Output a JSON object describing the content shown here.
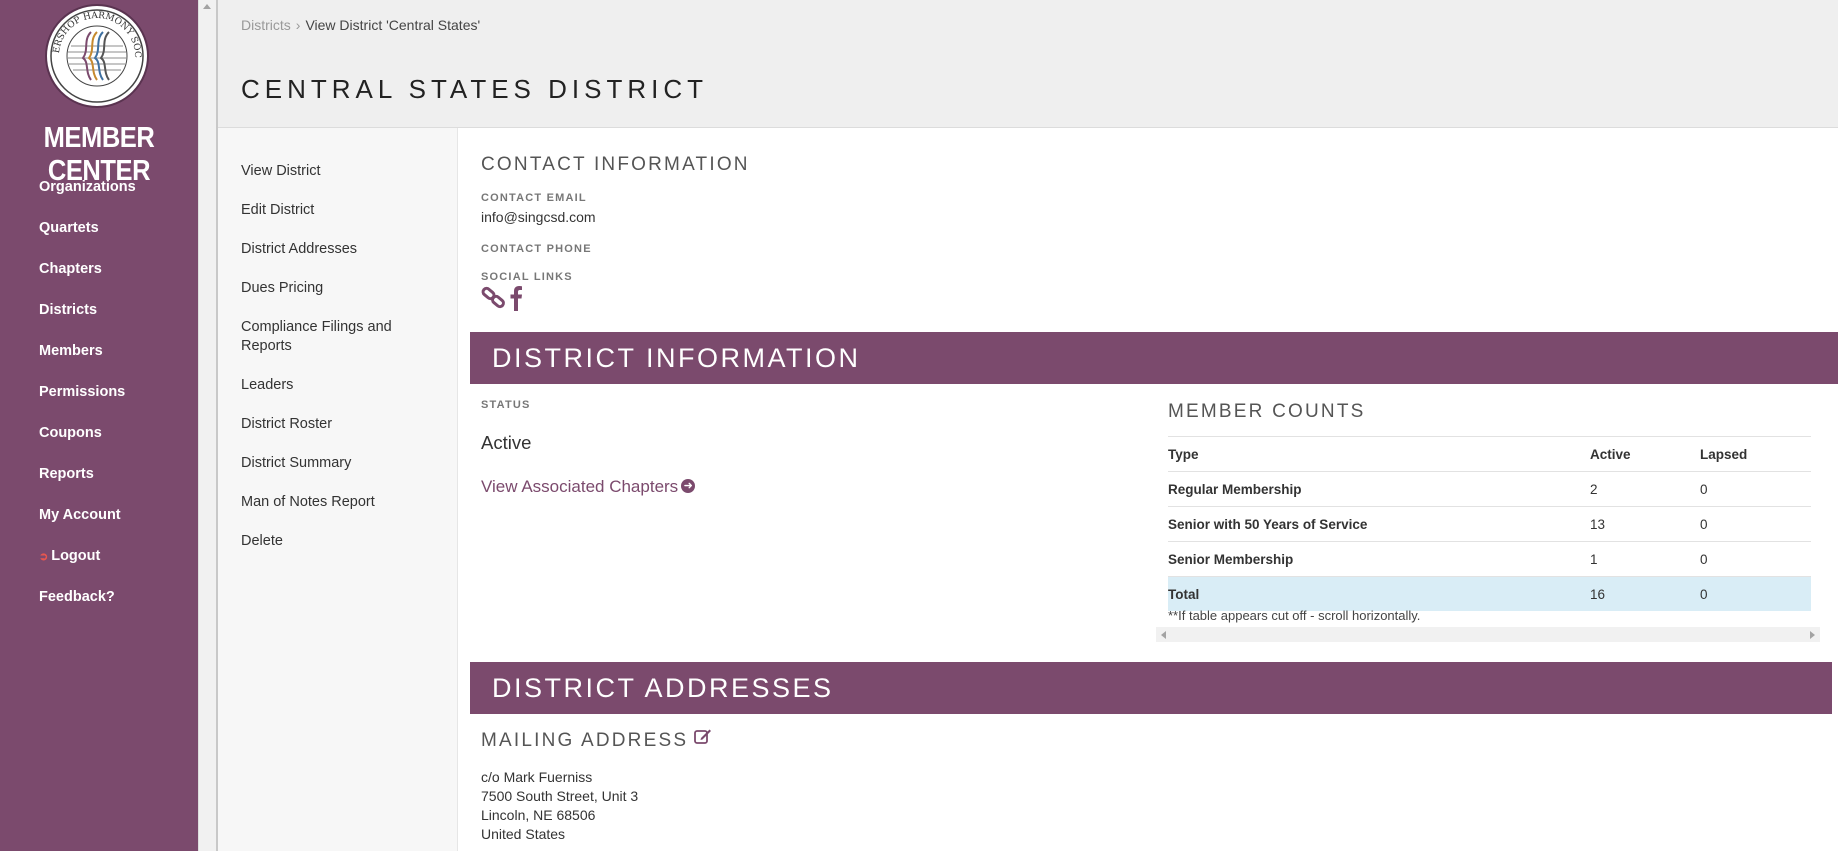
{
  "sidebar": {
    "logo_text": "BARBERSHOP HARMONY SOCIETY",
    "brand": "MEMBER CENTER",
    "items": [
      {
        "label": "Organizations"
      },
      {
        "label": "Quartets"
      },
      {
        "label": "Chapters"
      },
      {
        "label": "Districts"
      },
      {
        "label": "Members"
      },
      {
        "label": "Permissions"
      },
      {
        "label": "Coupons"
      },
      {
        "label": "Reports"
      },
      {
        "label": "My Account"
      },
      {
        "label": "Logout"
      },
      {
        "label": "Feedback?"
      }
    ]
  },
  "breadcrumb": {
    "parent": "Districts",
    "current": "View District 'Central States'"
  },
  "page_title": "CENTRAL STATES DISTRICT",
  "subnav": [
    "View District",
    "Edit District",
    "District Addresses",
    "Dues Pricing",
    "Compliance Filings and Reports",
    "Leaders",
    "District Roster",
    "District Summary",
    "Man of Notes Report",
    "Delete"
  ],
  "contact": {
    "heading": "CONTACT INFORMATION",
    "email_label": "CONTACT EMAIL",
    "email": "info@singcsd.com",
    "phone_label": "CONTACT PHONE",
    "social_label": "SOCIAL LINKS",
    "social_icons": [
      "link-icon",
      "facebook-icon"
    ]
  },
  "district_info": {
    "heading": "DISTRICT INFORMATION",
    "status_label": "STATUS",
    "status": "Active",
    "chapters_link": "View Associated Chapters"
  },
  "member_counts": {
    "heading": "MEMBER COUNTS",
    "columns": [
      "Type",
      "Active",
      "Lapsed"
    ],
    "rows": [
      {
        "type": "Regular Membership",
        "active": "2",
        "lapsed": "0"
      },
      {
        "type": "Senior with 50 Years of Service",
        "active": "13",
        "lapsed": "0"
      },
      {
        "type": "Senior Membership",
        "active": "1",
        "lapsed": "0"
      },
      {
        "type": "Total",
        "active": "16",
        "lapsed": "0"
      }
    ],
    "note": "**If table appears cut off - scroll horizontally."
  },
  "addresses": {
    "heading": "DISTRICT ADDRESSES",
    "mailing_heading": "MAILING ADDRESS",
    "mailing_lines": [
      "c/o Mark Fuerniss",
      "7500 South Street, Unit 3",
      "Lincoln, NE 68506",
      "United States"
    ]
  },
  "colors": {
    "brand_purple": "#7b4a6d",
    "total_row": "#d9edf6",
    "logout_icon": "#e8564f"
  }
}
